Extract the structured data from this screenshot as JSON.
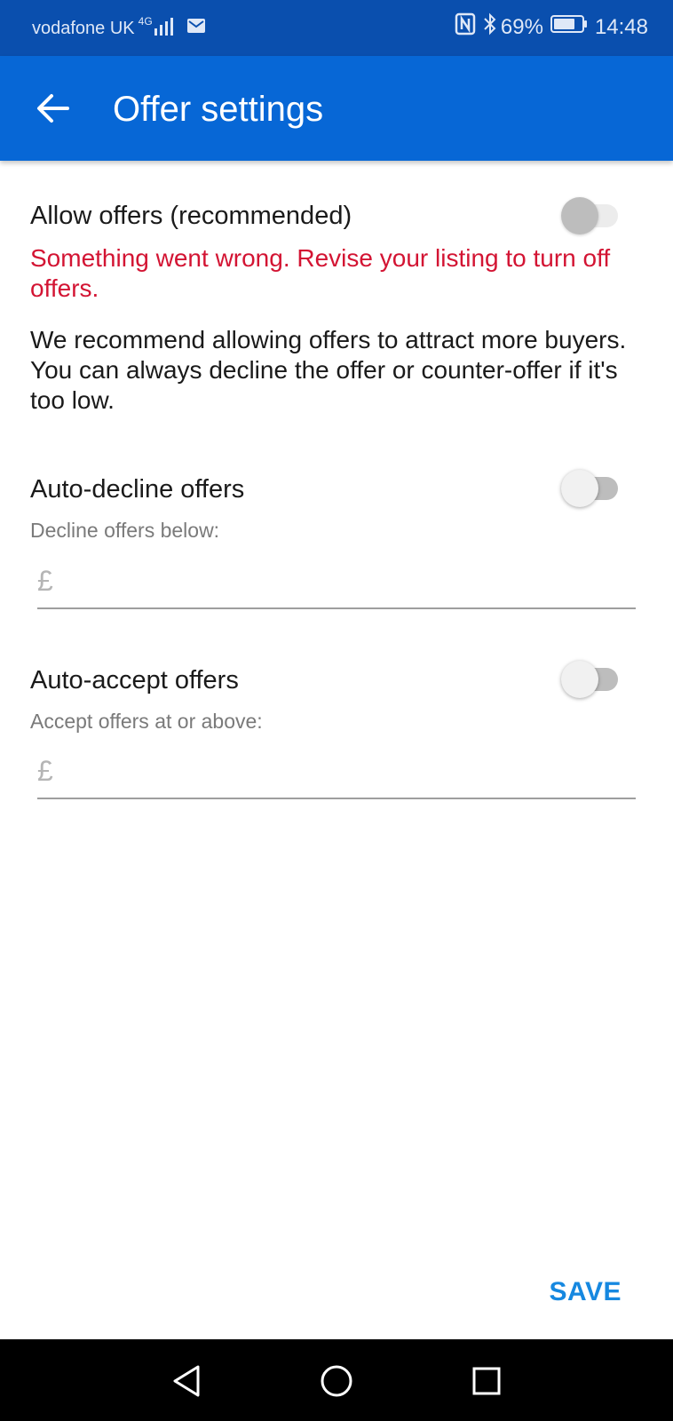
{
  "status_bar": {
    "carrier": "vodafone UK",
    "network_type": "4G",
    "battery_percent": "69%",
    "time": "14:48",
    "icons": [
      "signal-icon",
      "mail-icon",
      "nfc-icon",
      "bluetooth-icon",
      "battery-icon"
    ]
  },
  "app_bar": {
    "title": "Offer settings",
    "back_icon": "arrow-left-icon",
    "background_color": "#0767d6"
  },
  "allow_offers": {
    "label": "Allow offers (recommended)",
    "enabled": false,
    "error": "Something went wrong. Revise your listing to turn off offers.",
    "description": "We recommend allowing offers to attract more buyers. You can always decline the offer or counter-offer if it's too low."
  },
  "auto_decline": {
    "label": "Auto-decline offers",
    "enabled": false,
    "sub_label": "Decline offers below:",
    "currency": "£",
    "value": ""
  },
  "auto_accept": {
    "label": "Auto-accept offers",
    "enabled": false,
    "sub_label": "Accept offers at or above:",
    "currency": "£",
    "value": ""
  },
  "actions": {
    "save_label": "SAVE"
  },
  "colors": {
    "error": "#d31433",
    "accent": "#1688e0",
    "status_bar": "#0a4fae"
  },
  "nav_bar": {
    "icons": [
      "back-triangle-icon",
      "home-circle-icon",
      "recents-square-icon"
    ]
  }
}
